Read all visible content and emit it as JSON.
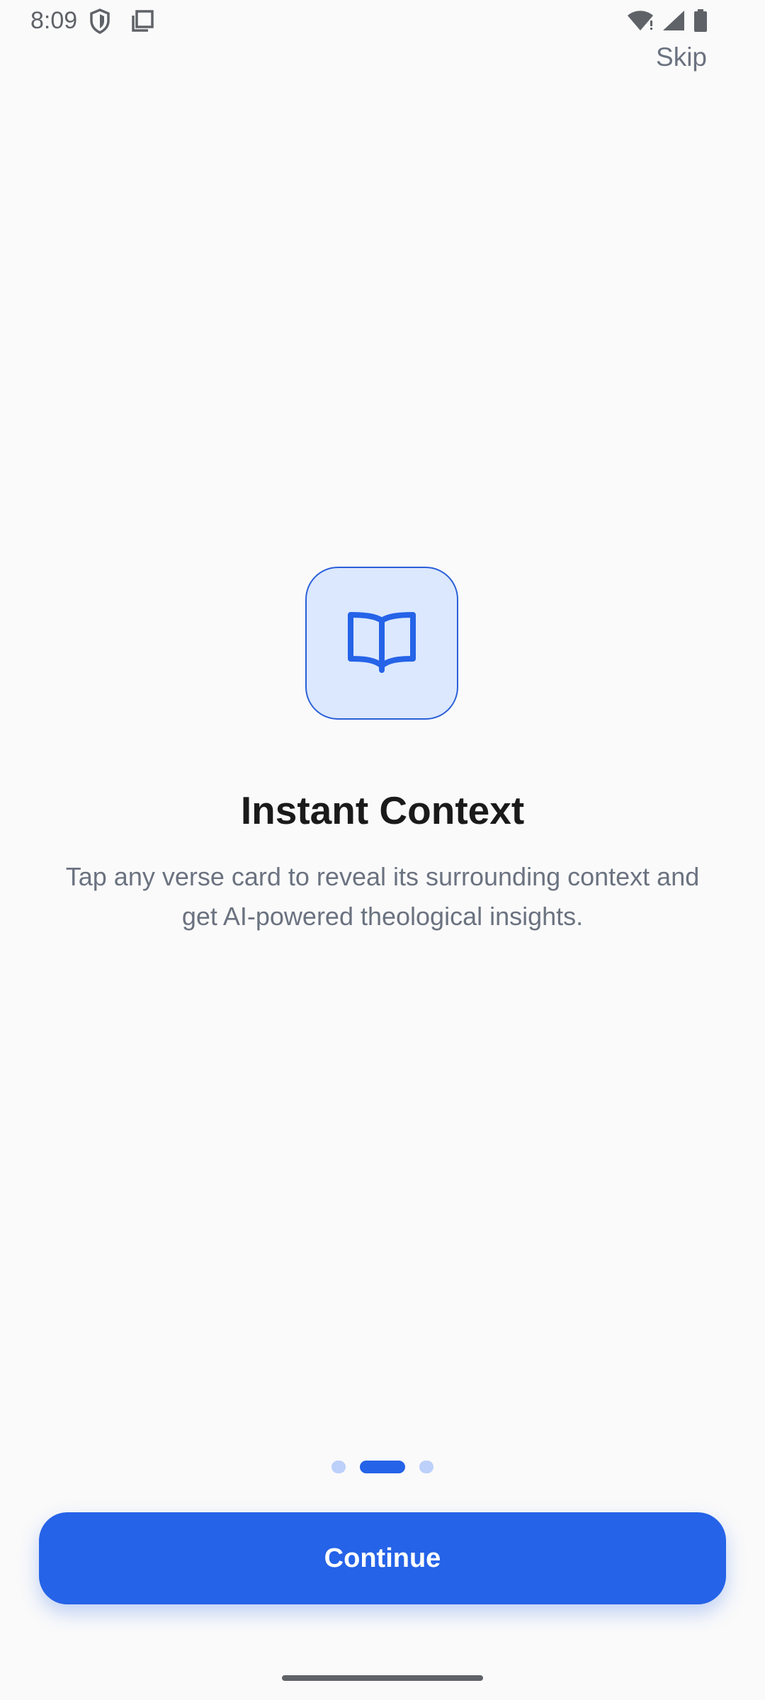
{
  "status_bar": {
    "time": "8:09",
    "icons_left": [
      "shield-icon",
      "copy-icon"
    ],
    "icons_right": [
      "wifi-icon",
      "signal-icon",
      "battery-icon"
    ]
  },
  "header": {
    "skip_label": "Skip"
  },
  "onboarding": {
    "icon": "open-book-icon",
    "title": "Instant Context",
    "description": "Tap any verse card to reveal its surrounding context and get AI-powered theological insights.",
    "pager": {
      "total": 3,
      "current": 2
    }
  },
  "footer": {
    "continue_label": "Continue"
  },
  "colors": {
    "accent": "#2563e8",
    "tile_bg": "#dbe8fe",
    "inactive_dot": "#bcd0fa",
    "text_primary": "#1a1a1a",
    "text_secondary": "#6b7280",
    "background": "#fafafa"
  }
}
